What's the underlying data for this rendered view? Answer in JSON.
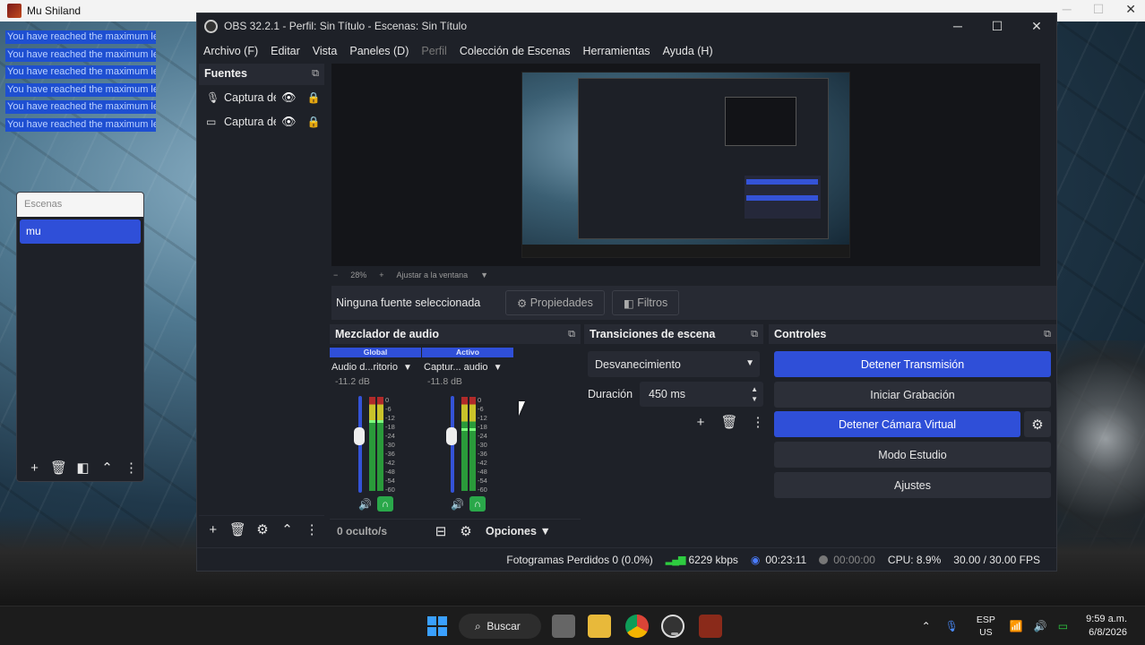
{
  "game": {
    "title": "Mu Shiland",
    "chat_lines": [
      "You have reached the maximum level",
      "You have reached the maximum level",
      "You have reached the maximum level",
      "You have reached the maximum level",
      "You have reached the maximum level",
      "You have reached the maximum level"
    ]
  },
  "scenes_dock": {
    "title": "Escenas",
    "items": [
      "mu"
    ]
  },
  "obs": {
    "title": "OBS 32.2.1 - Perfil: Sin Título - Escenas: Sin Título",
    "menu": {
      "archivo": "Archivo (F)",
      "editar": "Editar",
      "vista": "Vista",
      "paneles": "Paneles (D)",
      "perfil": "Perfil",
      "coleccion": "Colección de Escenas",
      "herramientas": "Herramientas",
      "ayuda": "Ayuda (H)"
    },
    "sources": {
      "title": "Fuentes",
      "items": [
        {
          "name": "Captura de audio",
          "icon": "microphone-icon"
        },
        {
          "name": "Captura de juego",
          "icon": "monitor-icon"
        }
      ]
    },
    "preview": {
      "zoom": "28%",
      "fit_label": "Ajustar a la ventana"
    },
    "no_source": {
      "label": "Ninguna fuente seleccionada",
      "properties": "Propiedades",
      "filters": "Filtros"
    },
    "mixer": {
      "title": "Mezclador de audio",
      "tab_global": "Global",
      "tab_active": "Activo",
      "channels": [
        {
          "name": "Audio d...ritorio",
          "db": "-11.2 dB",
          "level": 0.75
        },
        {
          "name": "Captur... audio",
          "db": "-11.8 dB",
          "level": 0.67
        }
      ],
      "scale": [
        "0",
        "-6",
        "-12",
        "-18",
        "-24",
        "-30",
        "-36",
        "-42",
        "-48",
        "-54",
        "-60"
      ],
      "hidden": "0 oculto/s",
      "options": "Opciones"
    },
    "transitions": {
      "title": "Transiciones de escena",
      "selected": "Desvanecimiento",
      "duration_label": "Duración",
      "duration_value": "450 ms"
    },
    "controls": {
      "title": "Controles",
      "stop_stream": "Detener Transmisión",
      "start_recording": "Iniciar Grabación",
      "stop_virtual_cam": "Detener Cámara Virtual",
      "studio_mode": "Modo Estudio",
      "settings": "Ajustes"
    },
    "status": {
      "dropped_frames": "Fotogramas Perdidos 0 (0.0%)",
      "bitrate": "6229 kbps",
      "stream_time": "00:23:11",
      "rec_time": "00:00:00",
      "cpu": "CPU: 8.9%",
      "fps": "30.00 / 30.00 FPS"
    }
  },
  "taskbar": {
    "search": "Buscar",
    "lang_top": "ESP",
    "lang_bottom": "US",
    "time": "9:59 a.m.",
    "date": "6/8/2026"
  },
  "colors": {
    "accent": "#2f4fd8",
    "panel": "#272a33",
    "background": "#1e2128",
    "meter_green": "#2a9a3a"
  }
}
